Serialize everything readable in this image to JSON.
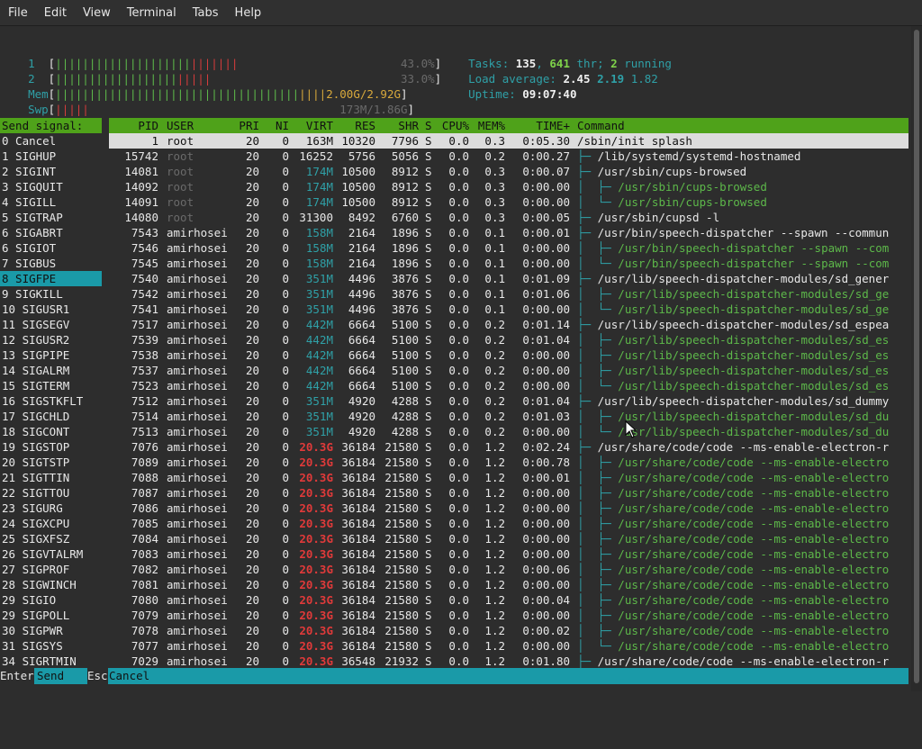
{
  "menu": [
    "File",
    "Edit",
    "View",
    "Terminal",
    "Tabs",
    "Help"
  ],
  "meters": {
    "cpu1": {
      "label": "1",
      "percent": "43.0%"
    },
    "cpu2": {
      "label": "2",
      "percent": "33.0%"
    },
    "mem": {
      "label": "Mem",
      "value": "2.00G/2.92G"
    },
    "swp": {
      "label": "Swp",
      "value": "173M/1.86G"
    }
  },
  "summary": {
    "tasks_label": "Tasks:",
    "tasks": "135",
    "thr": "641",
    "thr_label": "thr;",
    "running": "2",
    "running_label": "running",
    "load_label": "Load average:",
    "load1": "2.45",
    "load5": "2.19",
    "load15": "1.82",
    "uptime_label": "Uptime:",
    "uptime": "09:07:40"
  },
  "signals": {
    "header": "Send signal:",
    "selected_index": 9,
    "items": [
      "0 Cancel",
      "1 SIGHUP",
      "2 SIGINT",
      "3 SIGQUIT",
      "4 SIGILL",
      "5 SIGTRAP",
      "6 SIGABRT",
      "6 SIGIOT",
      "7 SIGBUS",
      "8 SIGFPE",
      "9 SIGKILL",
      "10 SIGUSR1",
      "11 SIGSEGV",
      "12 SIGUSR2",
      "13 SIGPIPE",
      "14 SIGALRM",
      "15 SIGTERM",
      "16 SIGSTKFLT",
      "17 SIGCHLD",
      "18 SIGCONT",
      "19 SIGSTOP",
      "20 SIGTSTP",
      "21 SIGTTIN",
      "22 SIGTTOU",
      "23 SIGURG",
      "24 SIGXCPU",
      "25 SIGXFSZ",
      "26 SIGVTALRM",
      "27 SIGPROF",
      "28 SIGWINCH",
      "29 SIGIO",
      "29 SIGPOLL",
      "30 SIGPWR",
      "31 SIGSYS",
      "34 SIGRTMIN"
    ]
  },
  "columns": [
    "PID",
    "USER",
    "PRI",
    "NI",
    "VIRT",
    "RES",
    "SHR",
    "S",
    "CPU%",
    "MEM%",
    "TIME+",
    "Command"
  ],
  "processes": [
    {
      "pid": "1",
      "user": "root",
      "pri": "20",
      "ni": "0",
      "virt": "163M",
      "res": "10320",
      "shr": "7796",
      "s": "S",
      "cpu": "0.0",
      "mem": "0.3",
      "time": "0:05.30",
      "tree": "",
      "cmd": "/sbin/init splash",
      "thread": false,
      "sel": true
    },
    {
      "pid": "15742",
      "user": "root",
      "pri": "20",
      "ni": "0",
      "virt": "16252",
      "res": "5756",
      "shr": "5056",
      "s": "S",
      "cpu": "0.0",
      "mem": "0.2",
      "time": "0:00.27",
      "tree": "├─ ",
      "cmd": "/lib/systemd/systemd-hostnamed",
      "thread": false
    },
    {
      "pid": "14081",
      "user": "root",
      "pri": "20",
      "ni": "0",
      "virt": "174M",
      "res": "10500",
      "shr": "8912",
      "s": "S",
      "cpu": "0.0",
      "mem": "0.3",
      "time": "0:00.07",
      "tree": "├─ ",
      "cmd": "/usr/sbin/cups-browsed",
      "thread": false
    },
    {
      "pid": "14092",
      "user": "root",
      "pri": "20",
      "ni": "0",
      "virt": "174M",
      "res": "10500",
      "shr": "8912",
      "s": "S",
      "cpu": "0.0",
      "mem": "0.3",
      "time": "0:00.00",
      "tree": "│  ├─ ",
      "cmd": "/usr/sbin/cups-browsed",
      "thread": true
    },
    {
      "pid": "14091",
      "user": "root",
      "pri": "20",
      "ni": "0",
      "virt": "174M",
      "res": "10500",
      "shr": "8912",
      "s": "S",
      "cpu": "0.0",
      "mem": "0.3",
      "time": "0:00.00",
      "tree": "│  └─ ",
      "cmd": "/usr/sbin/cups-browsed",
      "thread": true
    },
    {
      "pid": "14080",
      "user": "root",
      "pri": "20",
      "ni": "0",
      "virt": "31300",
      "res": "8492",
      "shr": "6760",
      "s": "S",
      "cpu": "0.0",
      "mem": "0.3",
      "time": "0:00.05",
      "tree": "├─ ",
      "cmd": "/usr/sbin/cupsd -l",
      "thread": false
    },
    {
      "pid": "7543",
      "user": "amirhosei",
      "pri": "20",
      "ni": "0",
      "virt": "158M",
      "res": "2164",
      "shr": "1896",
      "s": "S",
      "cpu": "0.0",
      "mem": "0.1",
      "time": "0:00.01",
      "tree": "├─ ",
      "cmd": "/usr/bin/speech-dispatcher --spawn --commun",
      "thread": false
    },
    {
      "pid": "7546",
      "user": "amirhosei",
      "pri": "20",
      "ni": "0",
      "virt": "158M",
      "res": "2164",
      "shr": "1896",
      "s": "S",
      "cpu": "0.0",
      "mem": "0.1",
      "time": "0:00.00",
      "tree": "│  ├─ ",
      "cmd": "/usr/bin/speech-dispatcher --spawn --com",
      "thread": true
    },
    {
      "pid": "7545",
      "user": "amirhosei",
      "pri": "20",
      "ni": "0",
      "virt": "158M",
      "res": "2164",
      "shr": "1896",
      "s": "S",
      "cpu": "0.0",
      "mem": "0.1",
      "time": "0:00.00",
      "tree": "│  └─ ",
      "cmd": "/usr/bin/speech-dispatcher --spawn --com",
      "thread": true
    },
    {
      "pid": "7540",
      "user": "amirhosei",
      "pri": "20",
      "ni": "0",
      "virt": "351M",
      "res": "4496",
      "shr": "3876",
      "s": "S",
      "cpu": "0.0",
      "mem": "0.1",
      "time": "0:01.09",
      "tree": "├─ ",
      "cmd": "/usr/lib/speech-dispatcher-modules/sd_gener",
      "thread": false
    },
    {
      "pid": "7542",
      "user": "amirhosei",
      "pri": "20",
      "ni": "0",
      "virt": "351M",
      "res": "4496",
      "shr": "3876",
      "s": "S",
      "cpu": "0.0",
      "mem": "0.1",
      "time": "0:01.06",
      "tree": "│  ├─ ",
      "cmd": "/usr/lib/speech-dispatcher-modules/sd_ge",
      "thread": true
    },
    {
      "pid": "7541",
      "user": "amirhosei",
      "pri": "20",
      "ni": "0",
      "virt": "351M",
      "res": "4496",
      "shr": "3876",
      "s": "S",
      "cpu": "0.0",
      "mem": "0.1",
      "time": "0:00.00",
      "tree": "│  └─ ",
      "cmd": "/usr/lib/speech-dispatcher-modules/sd_ge",
      "thread": true
    },
    {
      "pid": "7517",
      "user": "amirhosei",
      "pri": "20",
      "ni": "0",
      "virt": "442M",
      "res": "6664",
      "shr": "5100",
      "s": "S",
      "cpu": "0.0",
      "mem": "0.2",
      "time": "0:01.14",
      "tree": "├─ ",
      "cmd": "/usr/lib/speech-dispatcher-modules/sd_espea",
      "thread": false
    },
    {
      "pid": "7539",
      "user": "amirhosei",
      "pri": "20",
      "ni": "0",
      "virt": "442M",
      "res": "6664",
      "shr": "5100",
      "s": "S",
      "cpu": "0.0",
      "mem": "0.2",
      "time": "0:01.04",
      "tree": "│  ├─ ",
      "cmd": "/usr/lib/speech-dispatcher-modules/sd_es",
      "thread": true
    },
    {
      "pid": "7538",
      "user": "amirhosei",
      "pri": "20",
      "ni": "0",
      "virt": "442M",
      "res": "6664",
      "shr": "5100",
      "s": "S",
      "cpu": "0.0",
      "mem": "0.2",
      "time": "0:00.00",
      "tree": "│  ├─ ",
      "cmd": "/usr/lib/speech-dispatcher-modules/sd_es",
      "thread": true
    },
    {
      "pid": "7537",
      "user": "amirhosei",
      "pri": "20",
      "ni": "0",
      "virt": "442M",
      "res": "6664",
      "shr": "5100",
      "s": "S",
      "cpu": "0.0",
      "mem": "0.2",
      "time": "0:00.00",
      "tree": "│  ├─ ",
      "cmd": "/usr/lib/speech-dispatcher-modules/sd_es",
      "thread": true
    },
    {
      "pid": "7523",
      "user": "amirhosei",
      "pri": "20",
      "ni": "0",
      "virt": "442M",
      "res": "6664",
      "shr": "5100",
      "s": "S",
      "cpu": "0.0",
      "mem": "0.2",
      "time": "0:00.00",
      "tree": "│  └─ ",
      "cmd": "/usr/lib/speech-dispatcher-modules/sd_es",
      "thread": true
    },
    {
      "pid": "7512",
      "user": "amirhosei",
      "pri": "20",
      "ni": "0",
      "virt": "351M",
      "res": "4920",
      "shr": "4288",
      "s": "S",
      "cpu": "0.0",
      "mem": "0.2",
      "time": "0:01.04",
      "tree": "├─ ",
      "cmd": "/usr/lib/speech-dispatcher-modules/sd_dummy",
      "thread": false
    },
    {
      "pid": "7514",
      "user": "amirhosei",
      "pri": "20",
      "ni": "0",
      "virt": "351M",
      "res": "4920",
      "shr": "4288",
      "s": "S",
      "cpu": "0.0",
      "mem": "0.2",
      "time": "0:01.03",
      "tree": "│  ├─ ",
      "cmd": "/usr/lib/speech-dispatcher-modules/sd_du",
      "thread": true
    },
    {
      "pid": "7513",
      "user": "amirhosei",
      "pri": "20",
      "ni": "0",
      "virt": "351M",
      "res": "4920",
      "shr": "4288",
      "s": "S",
      "cpu": "0.0",
      "mem": "0.2",
      "time": "0:00.00",
      "tree": "│  └─ ",
      "cmd": "/usr/lib/speech-dispatcher-modules/sd_du",
      "thread": true
    },
    {
      "pid": "7076",
      "user": "amirhosei",
      "pri": "20",
      "ni": "0",
      "virt": "20.3G",
      "res": "36184",
      "shr": "21580",
      "s": "S",
      "cpu": "0.0",
      "mem": "1.2",
      "time": "0:02.24",
      "tree": "├─ ",
      "cmd": "/usr/share/code/code --ms-enable-electron-r",
      "thread": false,
      "big": true
    },
    {
      "pid": "7089",
      "user": "amirhosei",
      "pri": "20",
      "ni": "0",
      "virt": "20.3G",
      "res": "36184",
      "shr": "21580",
      "s": "S",
      "cpu": "0.0",
      "mem": "1.2",
      "time": "0:00.78",
      "tree": "│  ├─ ",
      "cmd": "/usr/share/code/code --ms-enable-electro",
      "thread": true,
      "big": true
    },
    {
      "pid": "7088",
      "user": "amirhosei",
      "pri": "20",
      "ni": "0",
      "virt": "20.3G",
      "res": "36184",
      "shr": "21580",
      "s": "S",
      "cpu": "0.0",
      "mem": "1.2",
      "time": "0:00.01",
      "tree": "│  ├─ ",
      "cmd": "/usr/share/code/code --ms-enable-electro",
      "thread": true,
      "big": true
    },
    {
      "pid": "7087",
      "user": "amirhosei",
      "pri": "20",
      "ni": "0",
      "virt": "20.3G",
      "res": "36184",
      "shr": "21580",
      "s": "S",
      "cpu": "0.0",
      "mem": "1.2",
      "time": "0:00.00",
      "tree": "│  ├─ ",
      "cmd": "/usr/share/code/code --ms-enable-electro",
      "thread": true,
      "big": true
    },
    {
      "pid": "7086",
      "user": "amirhosei",
      "pri": "20",
      "ni": "0",
      "virt": "20.3G",
      "res": "36184",
      "shr": "21580",
      "s": "S",
      "cpu": "0.0",
      "mem": "1.2",
      "time": "0:00.00",
      "tree": "│  ├─ ",
      "cmd": "/usr/share/code/code --ms-enable-electro",
      "thread": true,
      "big": true
    },
    {
      "pid": "7085",
      "user": "amirhosei",
      "pri": "20",
      "ni": "0",
      "virt": "20.3G",
      "res": "36184",
      "shr": "21580",
      "s": "S",
      "cpu": "0.0",
      "mem": "1.2",
      "time": "0:00.00",
      "tree": "│  ├─ ",
      "cmd": "/usr/share/code/code --ms-enable-electro",
      "thread": true,
      "big": true
    },
    {
      "pid": "7084",
      "user": "amirhosei",
      "pri": "20",
      "ni": "0",
      "virt": "20.3G",
      "res": "36184",
      "shr": "21580",
      "s": "S",
      "cpu": "0.0",
      "mem": "1.2",
      "time": "0:00.00",
      "tree": "│  ├─ ",
      "cmd": "/usr/share/code/code --ms-enable-electro",
      "thread": true,
      "big": true
    },
    {
      "pid": "7083",
      "user": "amirhosei",
      "pri": "20",
      "ni": "0",
      "virt": "20.3G",
      "res": "36184",
      "shr": "21580",
      "s": "S",
      "cpu": "0.0",
      "mem": "1.2",
      "time": "0:00.00",
      "tree": "│  ├─ ",
      "cmd": "/usr/share/code/code --ms-enable-electro",
      "thread": true,
      "big": true
    },
    {
      "pid": "7082",
      "user": "amirhosei",
      "pri": "20",
      "ni": "0",
      "virt": "20.3G",
      "res": "36184",
      "shr": "21580",
      "s": "S",
      "cpu": "0.0",
      "mem": "1.2",
      "time": "0:00.06",
      "tree": "│  ├─ ",
      "cmd": "/usr/share/code/code --ms-enable-electro",
      "thread": true,
      "big": true
    },
    {
      "pid": "7081",
      "user": "amirhosei",
      "pri": "20",
      "ni": "0",
      "virt": "20.3G",
      "res": "36184",
      "shr": "21580",
      "s": "S",
      "cpu": "0.0",
      "mem": "1.2",
      "time": "0:00.00",
      "tree": "│  ├─ ",
      "cmd": "/usr/share/code/code --ms-enable-electro",
      "thread": true,
      "big": true
    },
    {
      "pid": "7080",
      "user": "amirhosei",
      "pri": "20",
      "ni": "0",
      "virt": "20.3G",
      "res": "36184",
      "shr": "21580",
      "s": "S",
      "cpu": "0.0",
      "mem": "1.2",
      "time": "0:00.04",
      "tree": "│  ├─ ",
      "cmd": "/usr/share/code/code --ms-enable-electro",
      "thread": true,
      "big": true
    },
    {
      "pid": "7079",
      "user": "amirhosei",
      "pri": "20",
      "ni": "0",
      "virt": "20.3G",
      "res": "36184",
      "shr": "21580",
      "s": "S",
      "cpu": "0.0",
      "mem": "1.2",
      "time": "0:00.00",
      "tree": "│  ├─ ",
      "cmd": "/usr/share/code/code --ms-enable-electro",
      "thread": true,
      "big": true
    },
    {
      "pid": "7078",
      "user": "amirhosei",
      "pri": "20",
      "ni": "0",
      "virt": "20.3G",
      "res": "36184",
      "shr": "21580",
      "s": "S",
      "cpu": "0.0",
      "mem": "1.2",
      "time": "0:00.02",
      "tree": "│  ├─ ",
      "cmd": "/usr/share/code/code --ms-enable-electro",
      "thread": true,
      "big": true
    },
    {
      "pid": "7077",
      "user": "amirhosei",
      "pri": "20",
      "ni": "0",
      "virt": "20.3G",
      "res": "36184",
      "shr": "21580",
      "s": "S",
      "cpu": "0.0",
      "mem": "1.2",
      "time": "0:00.00",
      "tree": "│  └─ ",
      "cmd": "/usr/share/code/code --ms-enable-electro",
      "thread": true,
      "big": true
    },
    {
      "pid": "7029",
      "user": "amirhosei",
      "pri": "20",
      "ni": "0",
      "virt": "20.3G",
      "res": "36548",
      "shr": "21932",
      "s": "S",
      "cpu": "0.0",
      "mem": "1.2",
      "time": "0:01.80",
      "tree": "├─ ",
      "cmd": "/usr/share/code/code --ms-enable-electron-r",
      "thread": false,
      "big": true
    }
  ],
  "footer": {
    "k1": "Enter",
    "v1": "Send",
    "k2": "Esc",
    "v2": "Cancel"
  }
}
